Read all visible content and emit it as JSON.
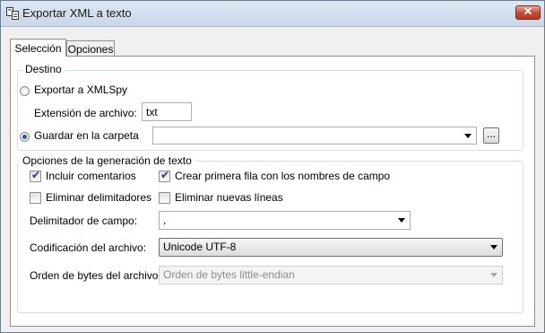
{
  "window": {
    "title": "Exportar XML a texto",
    "close_label": "✕"
  },
  "tabs": [
    {
      "label": "Selección",
      "active": true
    },
    {
      "label": "Opciones",
      "active": false
    }
  ],
  "destino": {
    "title": "Destino",
    "export_xmlspy_label": "Exportar a XMLSpy",
    "export_xmlspy_selected": false,
    "extension_label": "Extensión de archivo:",
    "extension_value": "txt",
    "save_folder_label": "Guardar en la carpeta",
    "save_folder_selected": true,
    "save_folder_value": "",
    "browse_label": "..."
  },
  "options": {
    "title": "Opciones de la generación de texto",
    "include_comments_label": "Incluir comentarios",
    "include_comments_checked": true,
    "first_row_label": "Crear primera fila con los nombres de campo",
    "first_row_checked": true,
    "remove_delimiters_label": "Eliminar delimitadores",
    "remove_delimiters_checked": false,
    "remove_newlines_label": "Eliminar nuevas líneas",
    "remove_newlines_checked": false,
    "field_delim_label": "Delimitador de campo:",
    "field_delim_value": ",",
    "encoding_label": "Codificación del archivo:",
    "encoding_value": "Unicode UTF-8",
    "byte_order_label": "Orden de bytes del archivo:",
    "byte_order_value": "Orden de bytes little-endian"
  },
  "colors": {
    "title_bar": "#c9d8ea",
    "close_button": "#c5472f",
    "radio_dot": "#1e5aa8"
  }
}
